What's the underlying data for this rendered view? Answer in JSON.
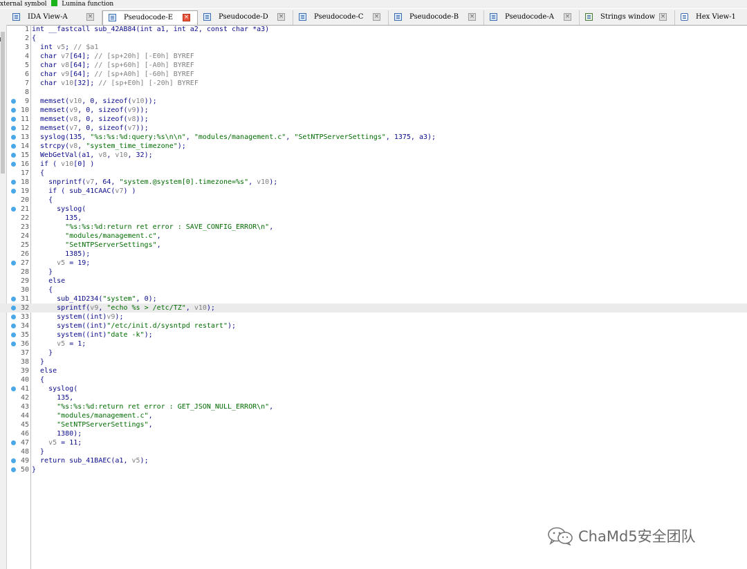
{
  "legend": {
    "item1_label": "xternal symbol",
    "item1_color": "#ff80ff",
    "item2_label": "Lumina function",
    "item2_color": "#1bb31b"
  },
  "tabs": [
    {
      "label": "IDA View-A",
      "icon": "ida-view-icon",
      "active": false
    },
    {
      "label": "Pseudocode-E",
      "icon": "pseudocode-icon",
      "active": true
    },
    {
      "label": "Pseudocode-D",
      "icon": "pseudocode-icon",
      "active": false
    },
    {
      "label": "Pseudocode-C",
      "icon": "pseudocode-icon",
      "active": false
    },
    {
      "label": "Pseudocode-B",
      "icon": "pseudocode-icon",
      "active": false
    },
    {
      "label": "Pseudocode-A",
      "icon": "pseudocode-icon",
      "active": false
    },
    {
      "label": "Strings window",
      "icon": "strings-icon",
      "active": false
    },
    {
      "label": "Hex View-1",
      "icon": "hex-view-icon",
      "active": false
    }
  ],
  "code": {
    "highlighted_line": 32,
    "breakpoint_lines": [
      9,
      10,
      11,
      12,
      13,
      14,
      15,
      16,
      18,
      19,
      21,
      27,
      31,
      32,
      33,
      34,
      35,
      36,
      41,
      47,
      49,
      50
    ],
    "lines": [
      "int __fastcall sub_42AB84(int a1, int a2, const char *a3)",
      "{",
      "  int v5; // $a1",
      "  char v7[64]; // [sp+20h] [-E0h] BYREF",
      "  char v8[64]; // [sp+60h] [-A0h] BYREF",
      "  char v9[64]; // [sp+A0h] [-60h] BYREF",
      "  char v10[32]; // [sp+E0h] [-20h] BYREF",
      "",
      "  memset(v10, 0, sizeof(v10));",
      "  memset(v9, 0, sizeof(v9));",
      "  memset(v8, 0, sizeof(v8));",
      "  memset(v7, 0, sizeof(v7));",
      "  syslog(135, \"%s:%s:%d:query:%s\\n\\n\", \"modules/management.c\", \"SetNTPServerSettings\", 1375, a3);",
      "  strcpy(v8, \"system_time_timezone\");",
      "  WebGetVal(a1, v8, v10, 32);",
      "  if ( v10[0] )",
      "  {",
      "    snprintf(v7, 64, \"system.@system[0].timezone=%s\", v10);",
      "    if ( sub_41CAAC(v7) )",
      "    {",
      "      syslog(",
      "        135,",
      "        \"%s:%s:%d:return ret error : SAVE_CONFIG_ERROR\\n\",",
      "        \"modules/management.c\",",
      "        \"SetNTPServerSettings\",",
      "        1385);",
      "      v5 = 19;",
      "    }",
      "    else",
      "    {",
      "      sub_41D234(\"system\", 0);",
      "      sprintf(v9, \"echo %s > /etc/TZ\", v10);",
      "      system((int)v9);",
      "      system((int)\"/etc/init.d/sysntpd restart\");",
      "      system((int)\"date -k\");",
      "      v5 = 1;",
      "    }",
      "  }",
      "  else",
      "  {",
      "    syslog(",
      "      135,",
      "      \"%s:%s:%d:return ret error : GET_JSON_NULL_ERROR\\n\",",
      "      \"modules/management.c\",",
      "      \"SetNTPServerSettings\",",
      "      1380);",
      "    v5 = 11;",
      "  }",
      "  return sub_41BAEC(a1, v5);",
      "}"
    ]
  },
  "watermark": {
    "text": "ChaMd5安全团队",
    "icon": "wechat-icon"
  }
}
